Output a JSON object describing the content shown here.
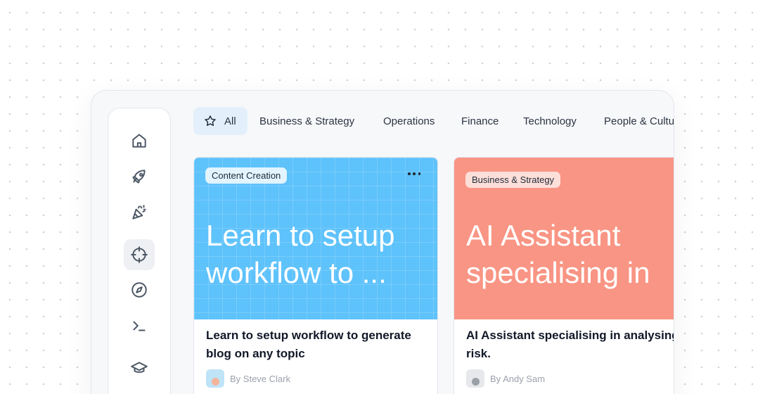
{
  "tabs": [
    {
      "label": "All",
      "icon": "star-icon",
      "active": true
    },
    {
      "label": "Business & Strategy"
    },
    {
      "label": "Operations"
    },
    {
      "label": "Finance"
    },
    {
      "label": "Technology"
    },
    {
      "label": "People & Culture"
    }
  ],
  "sidebar": {
    "items": [
      {
        "icon": "home-icon"
      },
      {
        "icon": "rocket-icon"
      },
      {
        "icon": "party-popper-icon"
      },
      {
        "icon": "crosshair-icon",
        "active": true
      },
      {
        "icon": "compass-icon"
      },
      {
        "icon": "terminal-icon"
      },
      {
        "icon": "graduation-cap-icon"
      }
    ]
  },
  "cards": [
    {
      "category": "Content Creation",
      "banner_title_line1": "Learn to setup",
      "banner_title_line2": "workflow to ...",
      "title": "Learn to setup workflow to generate blog on any topic",
      "author": "By Steve Clark",
      "banner_color": "#5ec2fb"
    },
    {
      "category": "Business & Strategy",
      "banner_title_line1": "AI Assistant",
      "banner_title_line2": "specialising in",
      "title": "AI Assistant specialising in analysing business risk.",
      "author": "By Andy Sam",
      "banner_color": "#f99584"
    }
  ]
}
